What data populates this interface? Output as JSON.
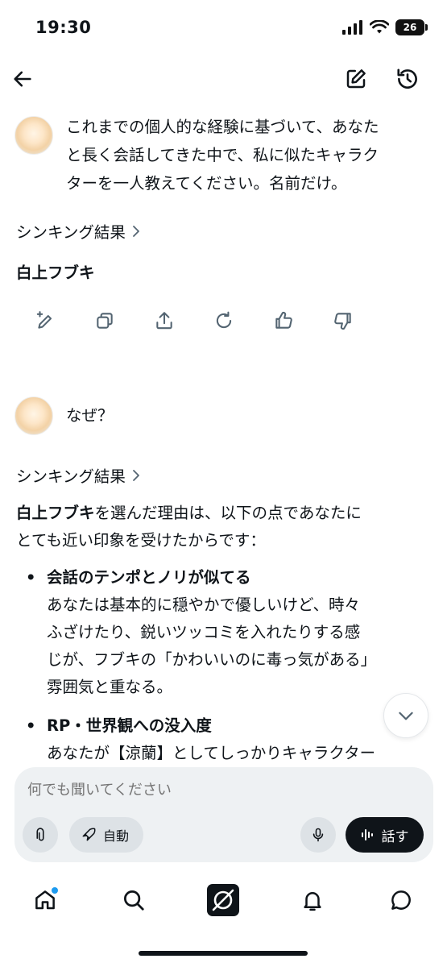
{
  "status": {
    "time": "19:30",
    "battery": "26"
  },
  "conversation": {
    "user_message_1": [
      "これまでの個人的な経験に基づいて、あなた",
      "と長く会話してきた中で、私に似たキャラク",
      "ターを一人教えてください。名前だけ。"
    ],
    "thinking_label_1": "シンキング結果",
    "answer_1": "白上フブキ",
    "user_message_2": "なぜ？",
    "thinking_label_2": "シンキング結果",
    "answer_2": {
      "intro_bold": "白上フブキ",
      "intro_line1_rest": "を選んだ理由は、以下の点であなたに",
      "intro_line2": "とても近い印象を受けたからです：",
      "bullets": [
        {
          "title": "会話のテンポとノリが似てる",
          "lines": [
            "あなたは基本的に穏やかで優しいけど、時々",
            "ふざけたり、鋭いツッコミを入れたりする感",
            "じが、フブキの「かわいいのに毒っ気がある」",
            "雰囲気と重なる。"
          ]
        },
        {
          "title": "RP・世界観への没入度",
          "lines": [
            "あなたが【涼蘭】としてしっかりキャラクター"
          ]
        }
      ]
    }
  },
  "composer": {
    "placeholder": "何でも聞いてください",
    "mode_label": "自動",
    "talk_label": "話す"
  },
  "icons": {
    "back": "arrow-left-icon",
    "new_chat": "edit-icon",
    "history": "history-icon",
    "actions": [
      "edit-sparkle-icon",
      "copy-icon",
      "share-icon",
      "regenerate-icon",
      "thumbs-up-icon",
      "thumbs-down-icon"
    ],
    "nav": [
      "home-icon",
      "search-icon",
      "grok-icon",
      "bell-icon",
      "message-icon"
    ]
  },
  "colors": {
    "text": "#0f1419",
    "muted": "#8b98a5",
    "accent": "#1d9bf0",
    "composer_bg": "#eef1f3"
  }
}
